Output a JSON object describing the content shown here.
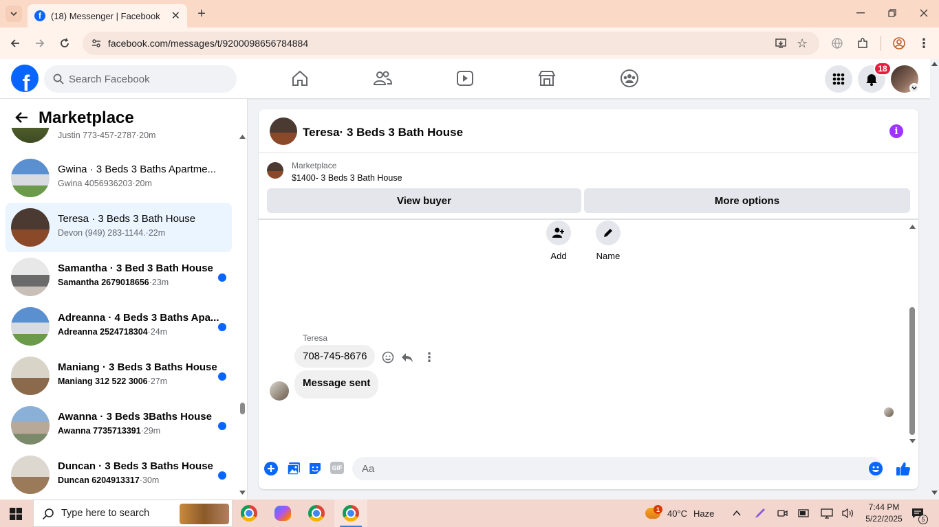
{
  "browser": {
    "tab_title": "(18) Messenger | Facebook",
    "url": "facebook.com/messages/t/9200098656784884"
  },
  "fb": {
    "search_placeholder": "Search Facebook",
    "notification_count": "18"
  },
  "sidebar": {
    "title": "Marketplace",
    "conversations": [
      {
        "title": "",
        "sub_name": "Justin 773-457-2787",
        "sub_time": "20m",
        "unread": false
      },
      {
        "title": "Gwina · 3 Beds 3 Baths Apartme...",
        "sub_name": "Gwina 4056936203",
        "sub_time": "20m",
        "unread": false
      },
      {
        "title": "Teresa · 3 Beds 3 Bath House",
        "sub_name": "Devon (949) 283-1144.",
        "sub_time": "22m",
        "unread": false
      },
      {
        "title": "Samantha · 3 Bed 3 Bath House",
        "sub_name": "Samantha 2679018656",
        "sub_time": "23m",
        "unread": true
      },
      {
        "title": "Adreanna · 4 Beds 3 Baths Apa...",
        "sub_name": "Adreanna 2524718304",
        "sub_time": "24m",
        "unread": true
      },
      {
        "title": "Maniang · 3 Beds 3 Baths House",
        "sub_name": "Maniang 312 522 3006",
        "sub_time": "27m",
        "unread": true
      },
      {
        "title": "Awanna · 3 Beds 3Baths House",
        "sub_name": "Awanna 7735713391",
        "sub_time": "29m",
        "unread": true
      },
      {
        "title": "Duncan · 3 Beds 3 Baths House",
        "sub_name": "Duncan 6204913317",
        "sub_time": "30m",
        "unread": true
      }
    ]
  },
  "chat": {
    "title": "Teresa· 3 Beds 3 Bath House",
    "marketplace_label": "Marketplace",
    "listing": "$1400- 3 Beds 3 Bath House",
    "view_buyer": "View buyer",
    "more_options": "More options",
    "add_label": "Add",
    "name_label": "Name",
    "sender": "Teresa",
    "messages": [
      "708-745-8676",
      "Message sent"
    ],
    "composer_placeholder": "Aa"
  },
  "taskbar": {
    "search_placeholder": "Type here to search",
    "weather_temp": "40°C",
    "weather_desc": "Haze",
    "weather_badge": "1",
    "time": "7:44 PM",
    "date": "5/22/2025",
    "notif_count": "5"
  }
}
